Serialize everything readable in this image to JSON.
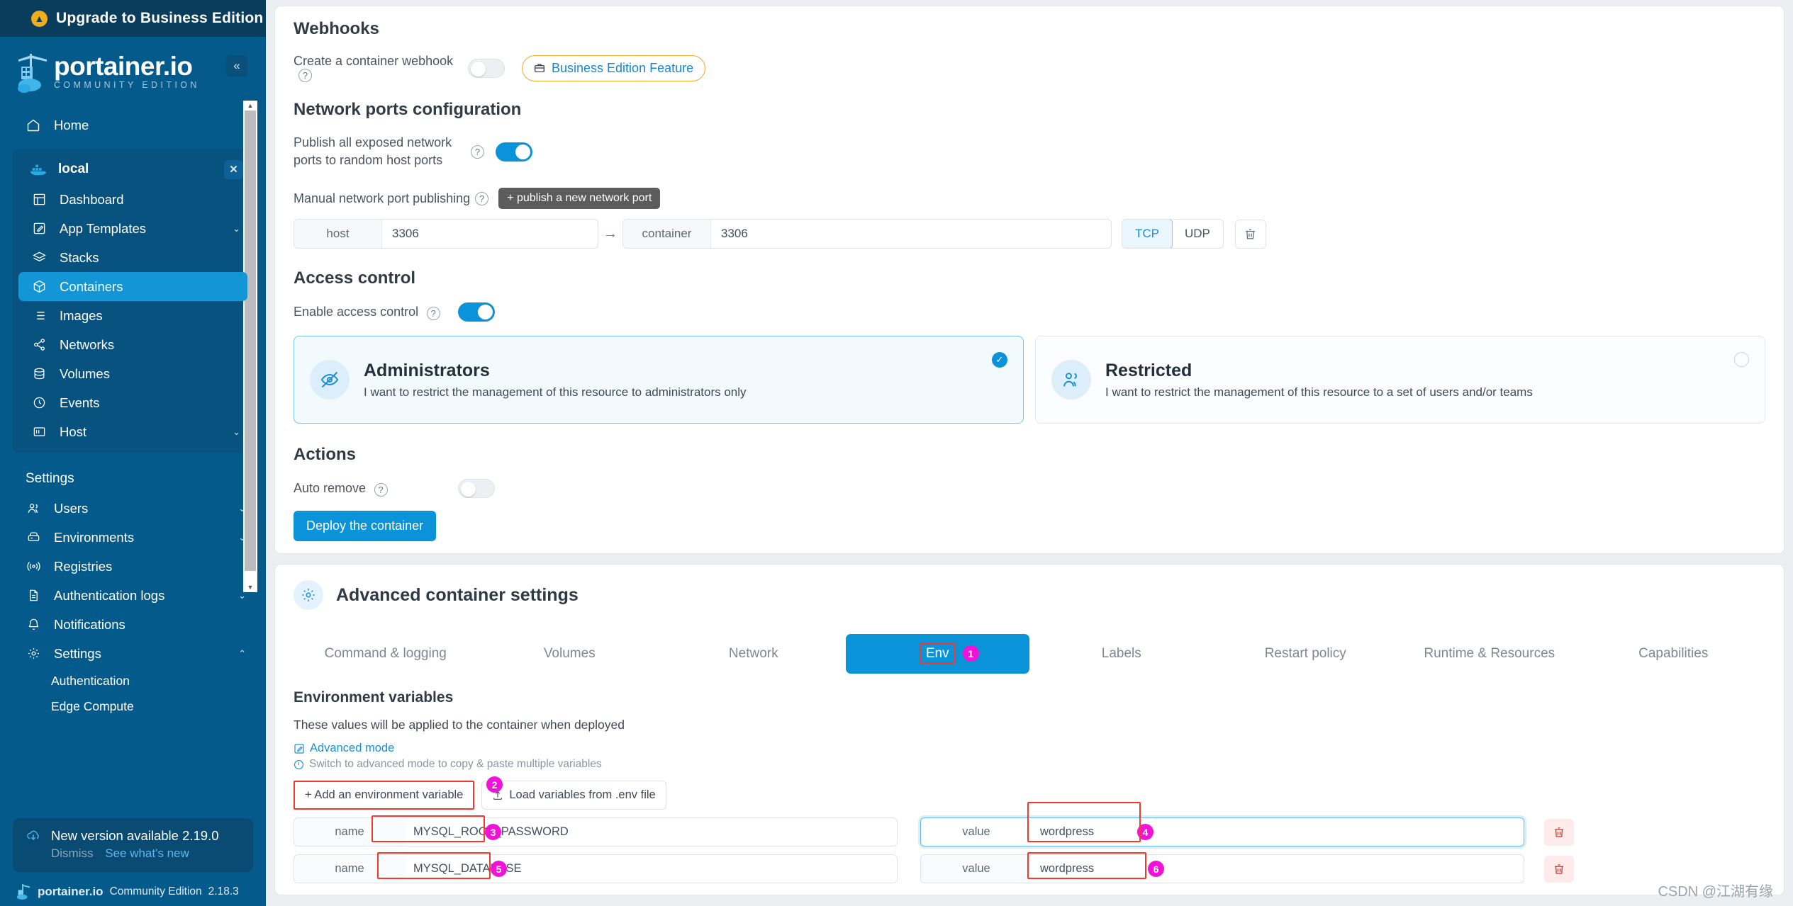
{
  "sidebar": {
    "upgrade_label": "Upgrade to Business Edition",
    "logo_title": "portainer.io",
    "logo_subtitle": "COMMUNITY EDITION",
    "home_label": "Home",
    "environment_name": "local",
    "env_items": [
      {
        "label": "Dashboard",
        "icon": "dashboard-icon",
        "chevron": ""
      },
      {
        "label": "App Templates",
        "icon": "templates-icon",
        "chevron": "⌄"
      },
      {
        "label": "Stacks",
        "icon": "stacks-icon",
        "chevron": ""
      },
      {
        "label": "Containers",
        "icon": "containers-icon",
        "chevron": "",
        "active": true
      },
      {
        "label": "Images",
        "icon": "images-icon",
        "chevron": ""
      },
      {
        "label": "Networks",
        "icon": "networks-icon",
        "chevron": ""
      },
      {
        "label": "Volumes",
        "icon": "volumes-icon",
        "chevron": ""
      },
      {
        "label": "Events",
        "icon": "events-icon",
        "chevron": ""
      },
      {
        "label": "Host",
        "icon": "host-icon",
        "chevron": "⌄"
      }
    ],
    "settings_label": "Settings",
    "settings_items": [
      {
        "label": "Users",
        "icon": "users-icon",
        "chevron": "⌄"
      },
      {
        "label": "Environments",
        "icon": "environments-icon",
        "chevron": "⌄"
      },
      {
        "label": "Registries",
        "icon": "registries-icon",
        "chevron": ""
      },
      {
        "label": "Authentication logs",
        "icon": "auth-logs-icon",
        "chevron": "⌄"
      },
      {
        "label": "Notifications",
        "icon": "bell-icon",
        "chevron": ""
      },
      {
        "label": "Settings",
        "icon": "gear-icon",
        "chevron": "⌃"
      }
    ],
    "settings_subitems": [
      "Authentication",
      "Edge Compute"
    ],
    "new_version_text": "New version available 2.19.0",
    "dismiss_label": "Dismiss",
    "see_whats_new_label": "See what's new",
    "footer_brand": "portainer.io",
    "footer_edition": "Community Edition",
    "footer_version": "2.18.3"
  },
  "main": {
    "webhooks": {
      "heading": "Webhooks",
      "create_label": "Create a container webhook",
      "toggle_state": "off",
      "business_badge": "Business Edition Feature"
    },
    "network_ports": {
      "heading": "Network ports configuration",
      "publish_all_label": "Publish all exposed network ports to random host ports",
      "publish_all_toggle": "on",
      "manual_label": "Manual network port publishing",
      "publish_new_btn": "+ publish a new network port",
      "host_addon": "host",
      "host_value": "3306",
      "arrow": "→",
      "container_addon": "container",
      "container_value": "3306",
      "protocol_options": [
        "TCP",
        "UDP"
      ],
      "protocol_selected": "TCP"
    },
    "access_control": {
      "heading": "Access control",
      "enable_label": "Enable access control",
      "enable_toggle": "on",
      "options": [
        {
          "title": "Administrators",
          "desc": "I want to restrict the management of this resource to administrators only",
          "icon": "eye-off-icon",
          "selected": true
        },
        {
          "title": "Restricted",
          "desc": "I want to restrict the management of this resource to a set of users and/or teams",
          "icon": "users-icon",
          "selected": false
        }
      ]
    },
    "actions": {
      "heading": "Actions",
      "auto_remove_label": "Auto remove",
      "auto_remove_toggle": "off",
      "deploy_label": "Deploy the container"
    },
    "advanced": {
      "title": "Advanced container settings",
      "tabs": [
        {
          "label": "Command & logging",
          "active": false
        },
        {
          "label": "Volumes",
          "active": false
        },
        {
          "label": "Network",
          "active": false
        },
        {
          "label": "Env",
          "active": true,
          "step": "1"
        },
        {
          "label": "Labels",
          "active": false
        },
        {
          "label": "Restart policy",
          "active": false
        },
        {
          "label": "Runtime & Resources",
          "active": false
        },
        {
          "label": "Capabilities",
          "active": false
        }
      ],
      "env_title": "Environment variables",
      "env_note": "These values will be applied to the container when deployed",
      "advanced_mode_label": "Advanced mode",
      "advanced_hint": "Switch to advanced mode to copy & paste multiple variables",
      "add_var_btn": "+ Add an environment variable",
      "add_var_step": "2",
      "load_env_btn": "Load variables from .env file",
      "name_addon": "name",
      "value_addon": "value",
      "rows": [
        {
          "name": "MYSQL_ROOT_PASSWORD",
          "name_step": "3",
          "value": "wordpress",
          "value_step": "4",
          "value_focused": true
        },
        {
          "name": "MYSQL_DATABASE",
          "name_step": "5",
          "value": "wordpress",
          "value_step": "6",
          "value_focused": false
        }
      ]
    },
    "watermark": "CSDN @江湖有缘"
  },
  "colors": {
    "accent": "#0b93d9",
    "sidebar": "#055a8c",
    "pink_step": "#f112d9",
    "red_box": "#f2392c",
    "orange": "#f0a92b"
  }
}
